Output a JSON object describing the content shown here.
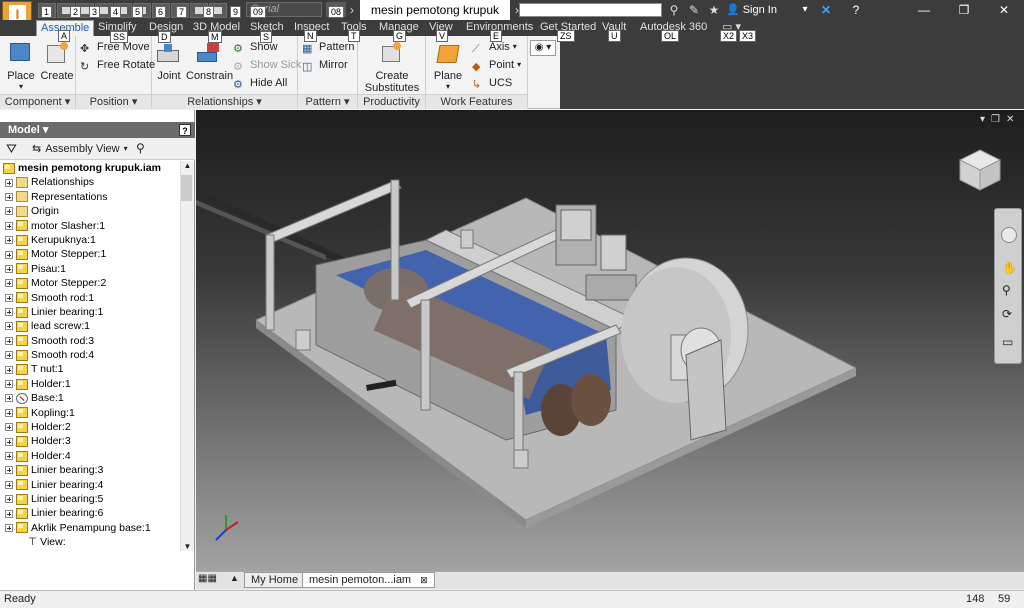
{
  "title_bar": {
    "document_title": "mesin pemotong krupuk",
    "font_box_text": "Serial",
    "sign_in": "Sign In",
    "app_letter": "I",
    "keytips_qat": [
      "1",
      "2",
      "3",
      "4",
      "5",
      "6",
      "7",
      "8",
      "9",
      "09",
      "08"
    ]
  },
  "tabs": [
    {
      "label": "Assemble",
      "keytip": "A",
      "active": true
    },
    {
      "label": "Simplify",
      "keytip": "SS"
    },
    {
      "label": "Design",
      "keytip": "D"
    },
    {
      "label": "3D Model",
      "keytip": "M"
    },
    {
      "label": "Sketch",
      "keytip": "S"
    },
    {
      "label": "Inspect",
      "keytip": "N"
    },
    {
      "label": "Tools",
      "keytip": "T"
    },
    {
      "label": "Manage",
      "keytip": "G"
    },
    {
      "label": "View",
      "keytip": "V"
    },
    {
      "label": "Environments",
      "keytip": "E"
    },
    {
      "label": "Get Started",
      "keytip": "ZS"
    },
    {
      "label": "Vault",
      "keytip": "U"
    },
    {
      "label": "Autodesk 360",
      "keytip": "OL"
    }
  ],
  "tab_extra_keytips": [
    "X2",
    "X3"
  ],
  "ribbon": {
    "component": {
      "label": "Component",
      "place": "Place",
      "create": "Create"
    },
    "position": {
      "label": "Position",
      "free_move": "Free Move",
      "free_rotate": "Free Rotate"
    },
    "relationships": {
      "label": "Relationships",
      "joint": "Joint",
      "constrain": "Constrain",
      "show": "Show",
      "show_sick": "Show Sick",
      "hide_all": "Hide All"
    },
    "pattern": {
      "label": "Pattern",
      "pattern": "Pattern",
      "mirror": "Mirror"
    },
    "productivity": {
      "label": "Productivity",
      "create_substitutes_1": "Create",
      "create_substitutes_2": "Substitutes"
    },
    "work_features": {
      "label": "Work Features",
      "plane": "Plane",
      "axis": "Axis",
      "point": "Point",
      "ucs": "UCS"
    }
  },
  "browser": {
    "header": "Model",
    "view_mode": "Assembly View",
    "root": "mesin pemotong krupuk.iam",
    "items": [
      {
        "label": "Relationships",
        "icon": "folder-icon"
      },
      {
        "label": "Representations",
        "icon": "representations-icon"
      },
      {
        "label": "Origin",
        "icon": "folder-icon"
      },
      {
        "label": "motor Slasher:1",
        "icon": "part-icon"
      },
      {
        "label": "Kerupuknya:1",
        "icon": "part-icon"
      },
      {
        "label": "Motor Stepper:1",
        "icon": "part-icon"
      },
      {
        "label": "Pisau:1",
        "icon": "part-icon"
      },
      {
        "label": "Motor Stepper:2",
        "icon": "part-icon"
      },
      {
        "label": "Smooth rod:1",
        "icon": "part-icon"
      },
      {
        "label": "Linier bearing:1",
        "icon": "part-icon"
      },
      {
        "label": "lead screw:1",
        "icon": "part-icon"
      },
      {
        "label": "Smooth rod:3",
        "icon": "part-icon"
      },
      {
        "label": "Smooth rod:4",
        "icon": "part-icon"
      },
      {
        "label": "T nut:1",
        "icon": "part-icon"
      },
      {
        "label": "Holder:1",
        "icon": "part-icon"
      },
      {
        "label": "Base:1",
        "icon": "grounded-part-icon"
      },
      {
        "label": "Kopling:1",
        "icon": "part-icon"
      },
      {
        "label": "Holder:2",
        "icon": "part-icon"
      },
      {
        "label": "Holder:3",
        "icon": "part-icon"
      },
      {
        "label": "Holder:4",
        "icon": "part-icon"
      },
      {
        "label": "Linier bearing:3",
        "icon": "part-icon"
      },
      {
        "label": "Linier bearing:4",
        "icon": "part-icon"
      },
      {
        "label": "Linier bearing:5",
        "icon": "part-icon"
      },
      {
        "label": "Linier bearing:6",
        "icon": "part-icon"
      },
      {
        "label": "Akrlik Penampung base:1",
        "icon": "part-icon"
      }
    ],
    "sub_item": "View:"
  },
  "doc_tabs": [
    {
      "label": "My Home",
      "active": false
    },
    {
      "label": "mesin pemoton...iam",
      "active": true
    }
  ],
  "status": {
    "left": "Ready",
    "count_a": "148",
    "count_b": "59"
  },
  "colors": {
    "accent": "#1a5fa8",
    "app_button": "#e8a33a",
    "dark_chrome": "#3c3c3c",
    "selection_blue": "#2b4fa8"
  }
}
